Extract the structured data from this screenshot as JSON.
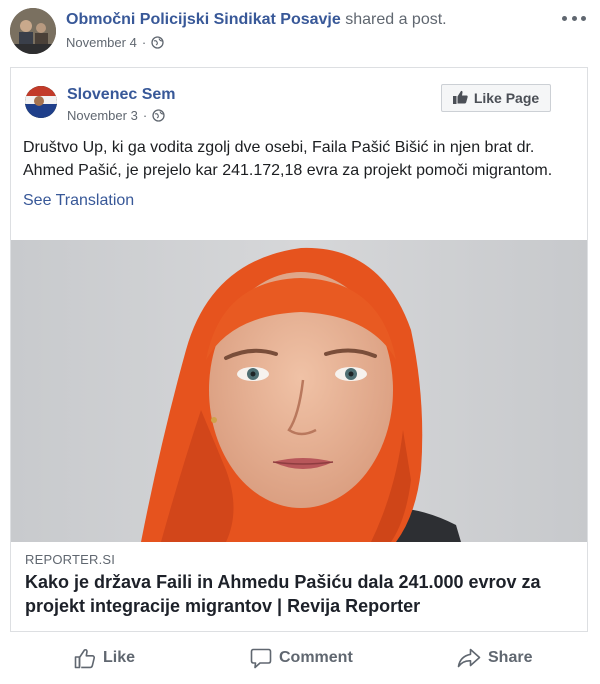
{
  "outer_post": {
    "author": "Območni Policijski Sindikat Posavje",
    "action_text": "shared a post.",
    "date": "November 4",
    "dot": "·"
  },
  "inner_post": {
    "author": "Slovenec Sem",
    "date": "November 3",
    "dot": "·",
    "like_page_label": "Like Page",
    "text": "Društvo Up, ki ga vodita zgolj dve osebi, Faila Pašić Bišić in njen brat dr. Ahmed Pašić, je prejelo kar 241.172,18 evra za projekt pomoči migrantom.",
    "see_translation": "See Translation"
  },
  "link_preview": {
    "source": "REPORTER.SI",
    "title": "Kako je država Faili in Ahmedu Pašiću dala 241.000 evrov za projekt integracije migrantov | Revija Reporter"
  },
  "actions": {
    "like": "Like",
    "comment": "Comment",
    "share": "Share"
  },
  "colors": {
    "link_blue": "#385898",
    "muted_gray": "#606770",
    "hijab_orange": "#e8541f"
  },
  "icons": [
    "globe-icon",
    "more-options-icon",
    "thumbs-up-icon",
    "comment-icon",
    "share-icon"
  ]
}
